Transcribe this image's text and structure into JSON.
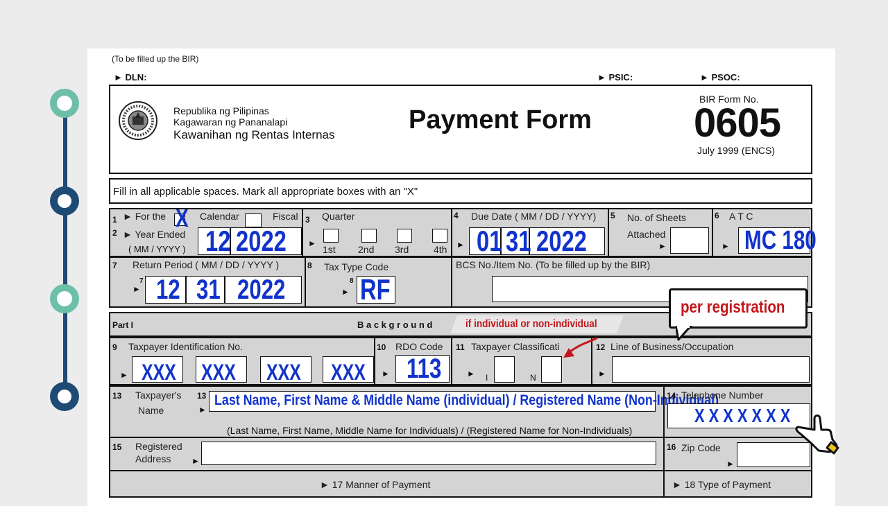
{
  "header": {
    "fill_note": "(To be filled up the BIR)",
    "dln": "► DLN:",
    "psic": "► PSIC:",
    "psoc": "► PSOC:"
  },
  "title_block": {
    "agency_line1": "Republika ng Pilipinas",
    "agency_line2": "Kagawaran ng Pananalapi",
    "agency_line3": "Kawanihan ng Rentas Internas",
    "form_title": "Payment Form",
    "form_no_label": "BIR Form No.",
    "form_no": "0605",
    "form_date": "July 1999 (ENCS)"
  },
  "instruction": "Fill in all applicable spaces.  Mark all appropriate boxes with an \"X\"",
  "row1": {
    "n1": "1",
    "for_the": "► For the",
    "calendar_mark": "X",
    "calendar": "Calendar",
    "fiscal": "Fiscal",
    "n2": "2",
    "year_ended": "► Year Ended",
    "mm_yyyy": "( MM / YYYY )",
    "year_month": "12",
    "year_year": "2022",
    "n3": "3",
    "quarter": "Quarter",
    "q1": "1st",
    "q2": "2nd",
    "q3": "3rd",
    "q4": "4th",
    "n4": "4",
    "due_date_label": "Due Date ( MM / DD / YYYY)",
    "due_mm": "01",
    "due_dd": "31",
    "due_yyyy": "2022",
    "n5": "5",
    "sheets_label": "No. of Sheets",
    "attached": "Attached",
    "n6": "6",
    "atc_label": "A T C",
    "atc_value": "MC 180"
  },
  "row2": {
    "n7": "7",
    "return_period": "Return Period ( MM / DD / YYYY )",
    "sub7": "7",
    "rp_mm": "12",
    "rp_dd": "31",
    "rp_yyyy": "2022",
    "n8": "8",
    "tax_type": "Tax Type Code",
    "sub8": "8",
    "tax_type_value": "RF",
    "bcs": "BCS No./Item No. (To be filled up by the  BIR)"
  },
  "part1": {
    "part": "Part I",
    "background": "B a c k g r o u n d",
    "banner": "if individual or non-individual",
    "callout": "per registration",
    "n9": "9",
    "tin_label": "Taxpayer Identification  No.",
    "tin": [
      "XXX",
      "XXX",
      "XXX",
      "XXX"
    ],
    "n10": "10",
    "rdo_label": "RDO Code",
    "rdo_value": "113",
    "n11": "11",
    "class_label": "Taxpayer Classificati",
    "class_i": "I",
    "class_n": "N",
    "n12": "12",
    "lob_label": "Line of Business/Occupation",
    "n13": "13",
    "name_label1": "Taxpayer's",
    "name_label2": "Name",
    "sub13": "13",
    "name_value": "Last Name, First Name & Middle Name (individual) / Registered Name (Non-Individual)",
    "name_hint": "(Last Name, First Name, Middle Name for Individuals) / (Registered Name for Non-Individuals)",
    "n14": "14",
    "tel_label": "Telephone Number",
    "tel_value": "X X X X X X X",
    "n15": "15",
    "addr_label1": "Registered",
    "addr_label2": "Address",
    "n16": "16",
    "zip_label": "Zip Code",
    "manner": "► 17  Manner of Payment",
    "type_payment": "► 18  Type of Payment"
  },
  "icons": {
    "seal": "bir-seal-icon",
    "hand": "pointing-hand-icon",
    "arrow": "red-arrow-icon"
  },
  "colors": {
    "timeline_teal": "#6dbfa8",
    "timeline_navy": "#1e4a74",
    "handwriting_blue": "#1133cc",
    "annotation_red": "#c4161c"
  }
}
